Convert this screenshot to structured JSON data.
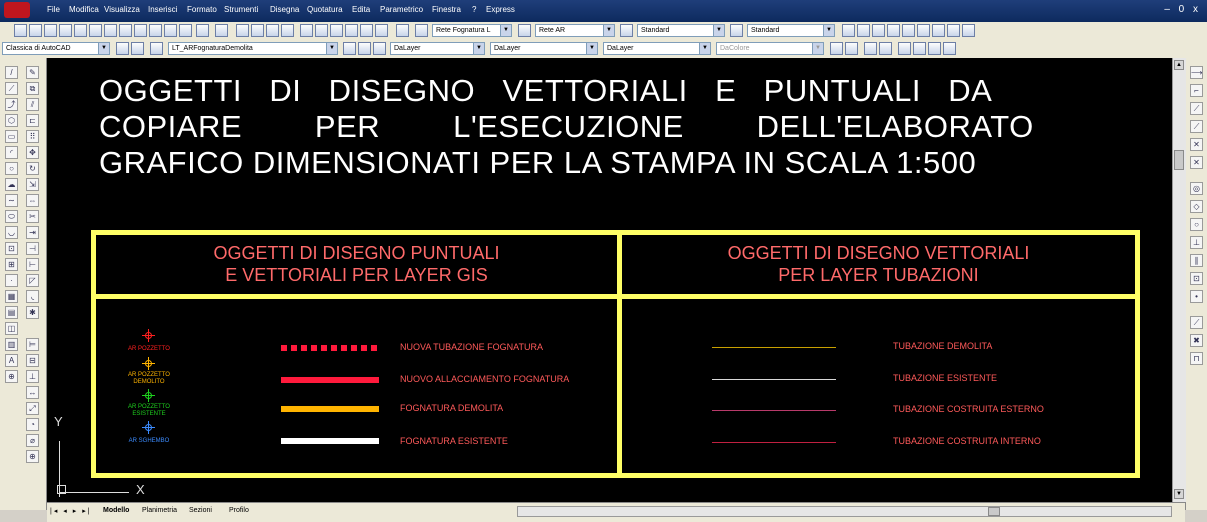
{
  "menu": {
    "items": [
      "File",
      "Modifica",
      "Visualizza",
      "Inserisci",
      "Formato",
      "Strumenti",
      "Disegna",
      "Quotatura",
      "Edita",
      "Parametrico",
      "Finestra",
      "?",
      "Express"
    ],
    "window_controls": "– 0 x"
  },
  "toolbar": {
    "rete_fognatura": "Rete Fognatura L",
    "rete_ar": "Rete AR",
    "style1": "Standard",
    "style2": "Standard",
    "workspace": "Classica di AutoCAD",
    "layer": "LT_ARFognaturaDemolita",
    "color": "DaLayer",
    "linetype": "DaLayer",
    "lineweight": "DaLayer",
    "plotstyle": "DaColore"
  },
  "drawing": {
    "title_lines": [
      "OGGETTI   DI   DISEGNO   VETTORIALI   E   PUNTUALI   DA",
      "COPIARE        PER        L'ESECUZIONE        DELL'ELABORATO",
      "GRAFICO DIMENSIONATI PER LA STAMPA IN SCALA 1:500"
    ],
    "left_header": [
      "OGGETTI DI DISEGNO PUNTUALI",
      "E VETTORIALI PER LAYER GIS"
    ],
    "right_header": [
      "OGGETTI DI DISEGNO VETTORIALI",
      "PER LAYER TUBAZIONI"
    ],
    "symbols": [
      {
        "label": "AR POZZETTO",
        "color": "#ff2020"
      },
      {
        "label": "AR POZZETTO DEMOLITO",
        "color": "#ffb400"
      },
      {
        "label": "AR POZZETTO ESISTENTE",
        "color": "#1ed11e"
      },
      {
        "label": "AR SGHEMBO",
        "color": "#3c8cff"
      }
    ],
    "left_lines": [
      {
        "label": "NUOVA TUBAZIONE FOGNATURA",
        "color": "#ff1a3c",
        "style": "dashed"
      },
      {
        "label": "NUOVO ALLACCIAMENTO FOGNATURA",
        "color": "#ff1a3c",
        "style": "solid"
      },
      {
        "label": "FOGNATURA DEMOLITA",
        "color": "#ffb400",
        "style": "solid"
      },
      {
        "label": "FOGNATURA ESISTENTE",
        "color": "#ffffff",
        "style": "solid"
      }
    ],
    "right_lines": [
      {
        "label": "TUBAZIONE DEMOLITA",
        "color": "#c8a000"
      },
      {
        "label": "TUBAZIONE ESISTENTE",
        "color": "#d8d8d8"
      },
      {
        "label": "TUBAZIONE COSTRUITA ESTERNO",
        "color": "#b83a6a"
      },
      {
        "label": "TUBAZIONE COSTRUITA INTERNO",
        "color": "#c02040"
      }
    ],
    "ucs_x": "X",
    "ucs_y": "Y"
  },
  "tabs": [
    "Modello",
    "Planimetria",
    "Sezioni",
    "Profilo"
  ],
  "colors": {
    "frame": "#ffff66",
    "header_text": "#ff6a6a"
  }
}
